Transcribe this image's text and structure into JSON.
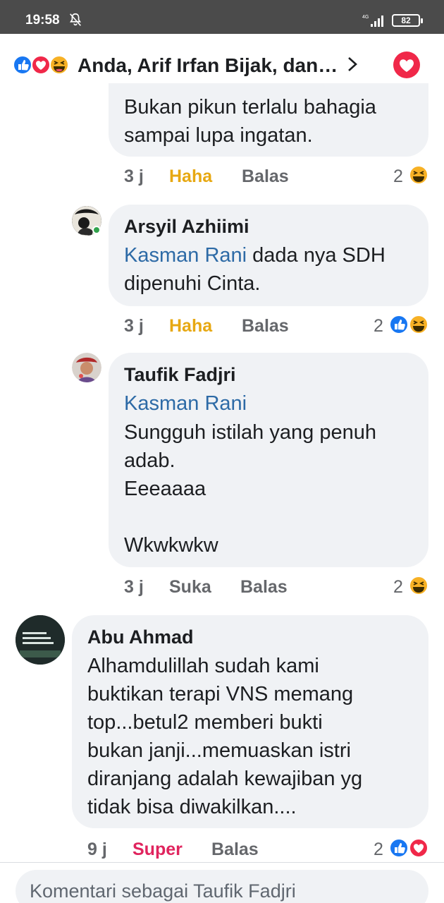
{
  "status_bar": {
    "time": "19:58",
    "network": "4G",
    "battery": "82"
  },
  "header": {
    "reactors": "Anda, Arif Irfan Bijak, dan…"
  },
  "comments": [
    {
      "text": "Bukan pikun terlalu bahagia\nsampai lupa ingatan.",
      "time": "3 j",
      "reaction_label": "Haha",
      "reply_label": "Balas",
      "reaction_count": "2"
    },
    {
      "author": "Arsyil Azhiimi",
      "mention": "Kasman Rani",
      "text": " dada nya SDH\ndipenuhi Cinta.",
      "time": "3 j",
      "reaction_label": "Haha",
      "reply_label": "Balas",
      "reaction_count": "2"
    },
    {
      "author": "Taufik Fadjri",
      "mention": "Kasman Rani",
      "text": "Sungguh istilah yang penuh\nadab.\nEeeaaaa\n\nWkwkwkw",
      "time": "3 j",
      "reaction_label": "Suka",
      "reply_label": "Balas",
      "reaction_count": "2"
    },
    {
      "author": "Abu Ahmad",
      "text": "Alhamdulillah sudah kami\nbuktikan terapi VNS memang\ntop...betul2 memberi bukti\nbukan janji...memuaskan istri\ndiranjang adalah kewajiban yg\ntidak bisa diwakilkan....",
      "time": "9 j",
      "reaction_label": "Super",
      "reply_label": "Balas",
      "reaction_count": "2"
    }
  ],
  "composer": {
    "placeholder": "Komentari sebagai Taufik Fadjri"
  },
  "colors": {
    "link": "#2d6aa6",
    "haha": "#e7a812",
    "super": "#e0245e",
    "like": "#1877f2",
    "love": "#f02849",
    "bubble": "#f0f2f5"
  }
}
